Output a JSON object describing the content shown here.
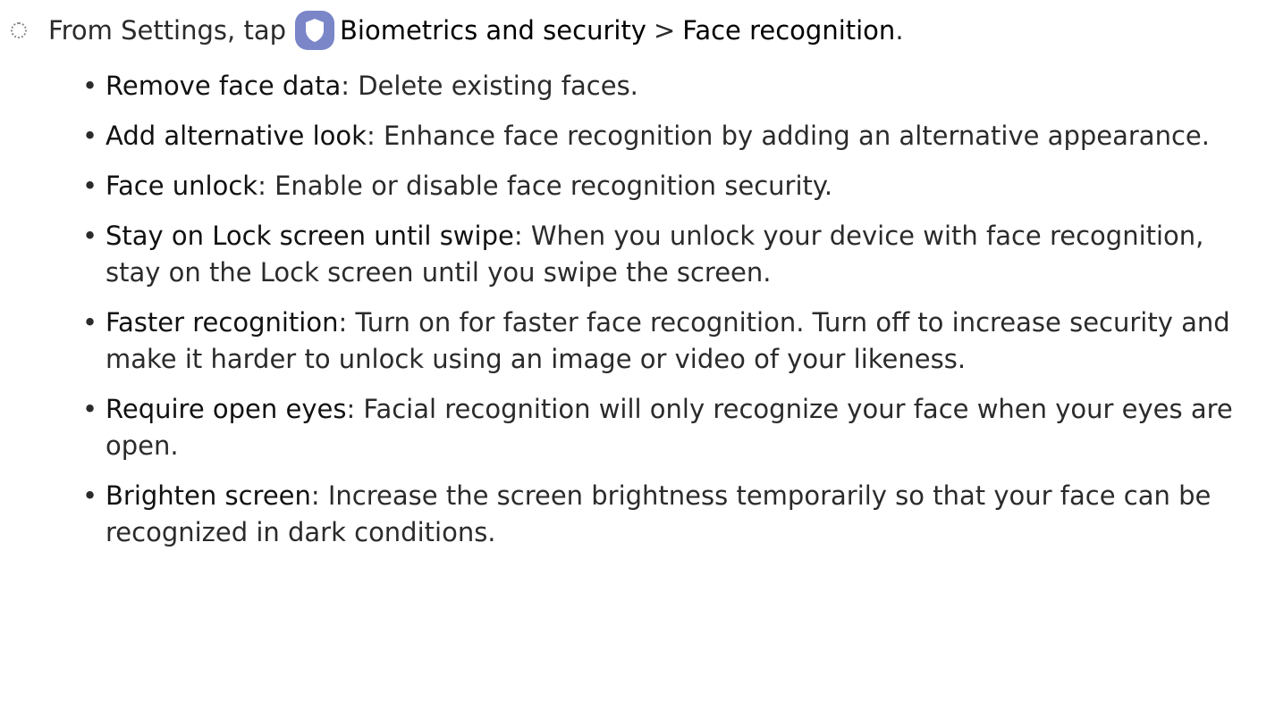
{
  "step": {
    "prefix": "From Settings, tap",
    "app_icon": "shield-icon",
    "menu_item": "Biometrics and security",
    "separator": ">",
    "submenu_item": "Face recognition",
    "end": "."
  },
  "options": [
    {
      "name": "Remove face data",
      "description": ": Delete existing faces."
    },
    {
      "name": "Add alternative look",
      "description": ": Enhance face recognition by adding an alternative appearance."
    },
    {
      "name": "Face unlock",
      "description": ": Enable or disable face recognition security."
    },
    {
      "name": "Stay on Lock screen until swipe",
      "description": ": When you unlock your device with face recognition, stay on the Lock screen until you swipe the screen."
    },
    {
      "name": "Faster recognition",
      "description": ": Turn on for faster face recognition. Turn off to increase security and make it harder to unlock using an image or video of your likeness."
    },
    {
      "name": "Require open eyes",
      "description": ": Facial recognition will only recognize your face when your eyes are open."
    },
    {
      "name": "Brighten screen",
      "description": ": Increase the screen brightness temporarily so that your face can be recognized in dark conditions."
    }
  ],
  "bullet_char": "•",
  "colors": {
    "icon_background": "#7a86c8",
    "icon_foreground": "#ffffff",
    "text": "#2b2b2b"
  }
}
